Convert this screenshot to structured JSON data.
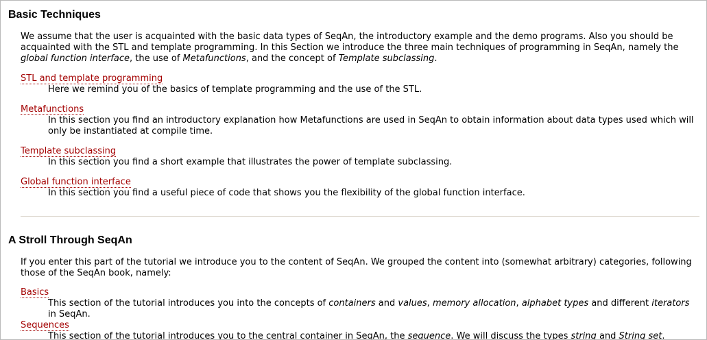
{
  "section1": {
    "title": "Basic Techniques",
    "intro": {
      "t1": "We assume that the user is acquainted with the basic data types of SeqAn, the introductory example and the demo programs. Also you should be acquainted with the STL and template programming. In this Section we introduce the three main techniques of programming in SeqAn, namely the ",
      "e1": "global function interface",
      "t2": ", the use of ",
      "e2": "Metafunctions",
      "t3": ", and the concept of ",
      "e3": "Template subclassing",
      "t4": "."
    },
    "items": [
      {
        "link": "STL and template programming",
        "desc": "Here we remind you of the basics of template programming and the use of the STL."
      },
      {
        "link": "Metafunctions",
        "desc": "In this section you find an introductory explanation how Metafunctions are used in SeqAn to obtain information about data types used which will only be instantiated at compile time."
      },
      {
        "link": "Template subclassing",
        "desc": "In this section you find a short example that illustrates the power of template subclassing."
      },
      {
        "link": "Global function interface",
        "desc": "In this section you find a useful piece of code that shows you the flexibility of the global function interface."
      }
    ]
  },
  "section2": {
    "title": "A Stroll Through SeqAn",
    "intro": "If you enter this part of the tutorial we introduce you to the content of SeqAn. We grouped the content into (somewhat arbitrary) categories, following those of the SeqAn book, namely:",
    "basics": {
      "link": "Basics",
      "t1": "This section of the tutorial introduces you into the concepts of ",
      "e1": "containers",
      "t2": " and ",
      "e2": "values",
      "t3": ", ",
      "e3": "memory allocation",
      "t4": ", ",
      "e4": "alphabet types",
      "t5": " and different ",
      "e5": "iterators",
      "t6": " in SeqAn."
    },
    "sequences": {
      "link": "Sequences",
      "t1": "This section of the tutorial introduces you to the central container in SeqAn, the ",
      "e1": "sequence",
      "t2": ". We will discuss the types ",
      "e2": "string",
      "t3": " and ",
      "e3": "String set",
      "t4": "."
    }
  }
}
